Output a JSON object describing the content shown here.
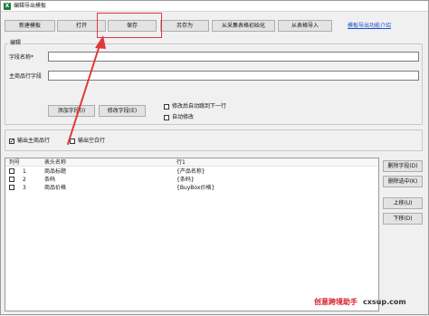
{
  "window": {
    "title": "编辑导出模板",
    "app_icon": "excel-icon"
  },
  "toolbar": {
    "new_template": "新建模板",
    "open": "打开",
    "save": "保存",
    "save_as": "另存为",
    "init_from_sheet": "从采集表格初始化",
    "import_from_sheet": "从表格导入",
    "help_link": "模板导出功能介绍"
  },
  "edit_group": {
    "title": "编辑",
    "field_name_label": "字段名称*",
    "field_name_value": "",
    "main_row_field_label": "主商品行字段",
    "main_row_field_value": "",
    "add_field_button": "添加字段(I)",
    "modify_field_button": "修改字段(E)",
    "jump_next_row_label": "修改后自动跳到下一行",
    "jump_next_row_checked": false,
    "auto_modify_label": "自动修改",
    "auto_modify_checked": false
  },
  "options": {
    "output_main_row_label": "输出主商品行",
    "output_main_row_checked": true,
    "output_blank_row_label": "输出空白行",
    "output_blank_row_checked": false
  },
  "table": {
    "headers": [
      "列号",
      "表头名称",
      "行1"
    ],
    "rows": [
      {
        "checked": false,
        "num": "1",
        "name": "商品标题",
        "row1": "{产品名称}"
      },
      {
        "checked": false,
        "num": "2",
        "name": "条码",
        "row1": "{条码}"
      },
      {
        "checked": false,
        "num": "3",
        "name": "商品价格",
        "row1": "{BuyBox价格}"
      }
    ]
  },
  "side_buttons": {
    "delete_field": "删除字段(D)",
    "delete_selected": "删除选中(K)",
    "move_up": "上移(U)",
    "move_down": "下移(D)"
  },
  "annotation": {
    "color": "#e0393b"
  },
  "watermark": {
    "brand": "创意跨境助手",
    "site": "cxsup.com"
  }
}
